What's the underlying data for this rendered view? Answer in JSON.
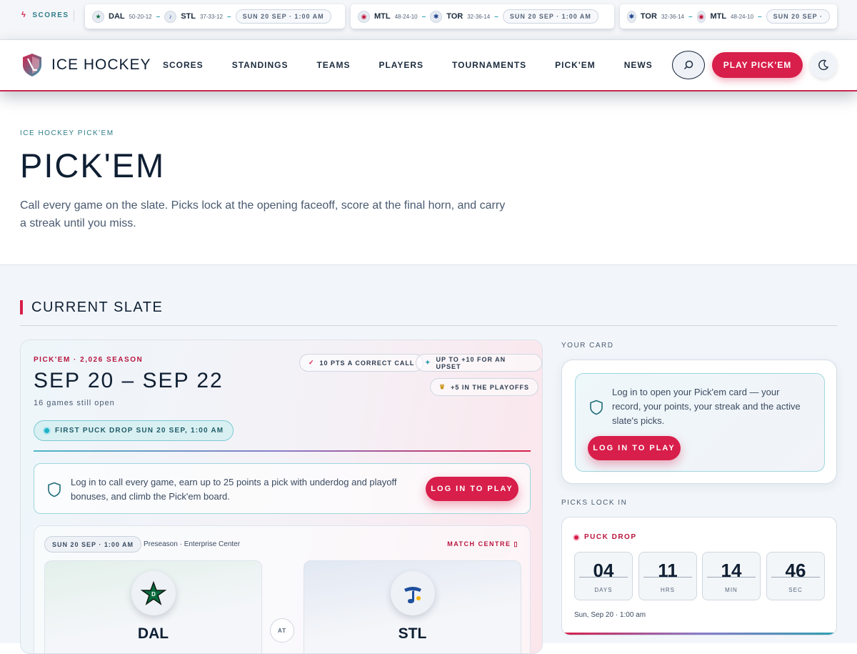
{
  "ticker": {
    "label": "SCORES",
    "games": [
      {
        "away": "DAL",
        "away_record": "50-20-12",
        "home": "STL",
        "home_record": "37-33-12",
        "date": "SUN 20 SEP · 1:00 AM"
      },
      {
        "away": "MTL",
        "away_record": "48-24-10",
        "home": "TOR",
        "home_record": "32-36-14",
        "date": "SUN 20 SEP · 1:00 AM"
      },
      {
        "away": "TOR",
        "away_record": "32-36-14",
        "home": "MTL",
        "home_record": "48-24-10",
        "date": "SUN 20 SEP ·"
      }
    ]
  },
  "header": {
    "brand": "ICE HOCKEY",
    "nav": [
      "SCORES",
      "STANDINGS",
      "TEAMS",
      "PLAYERS",
      "TOURNAMENTS",
      "PICK'EM",
      "NEWS"
    ],
    "play_label": "PLAY PICK'EM"
  },
  "hero": {
    "breadcrumb": "ICE HOCKEY PICK'EM",
    "title": "PICK'EM",
    "lead": "Call every game on the slate. Picks lock at the opening faceoff, score at the final horn, and carry a streak until you miss."
  },
  "slate": {
    "section_title": "CURRENT SLATE",
    "season": "PICK'EM · 2,026 SEASON",
    "range": "SEP 20 – SEP 22",
    "open_games": "16 games still open",
    "first_puck": "FIRST PUCK DROP SUN 20 SEP, 1:00 AM",
    "chips": [
      "10 PTS A CORRECT CALL",
      "UP TO +10 FOR AN UPSET",
      "+5 IN THE PLAYOFFS"
    ],
    "login_text": "Log in to call every game, earn up to 25 points a pick with underdog and playoff bonuses, and climb the Pick'em board.",
    "login_button": "LOG IN TO PLAY",
    "game": {
      "date": "SUN 20 SEP · 1:00 AM",
      "venue": "Preseason · Enterprise Center",
      "match_centre": "MATCH CENTRE",
      "away": "DAL",
      "home": "STL",
      "at": "AT"
    }
  },
  "your_card": {
    "label": "YOUR CARD",
    "text": "Log in to open your Pick'em card — your record, your points, your streak and the active slate's picks.",
    "button": "LOG IN TO PLAY"
  },
  "picks_lock": {
    "label": "PICKS LOCK IN",
    "puck_drop": "PUCK DROP",
    "countdown": [
      {
        "value": "04",
        "unit": "DAYS"
      },
      {
        "value": "11",
        "unit": "HRS"
      },
      {
        "value": "14",
        "unit": "MIN"
      },
      {
        "value": "46",
        "unit": "SEC"
      }
    ],
    "date": "Sun, Sep 20 · 1:00 am"
  },
  "colors": {
    "accent": "#d81e4a",
    "teal": "#2f9fb0",
    "ink": "#0f1f33"
  },
  "icons": [
    "bolt-icon",
    "search-icon",
    "moon-icon",
    "shield-icon",
    "check-icon",
    "star-icon",
    "trophy-icon"
  ]
}
